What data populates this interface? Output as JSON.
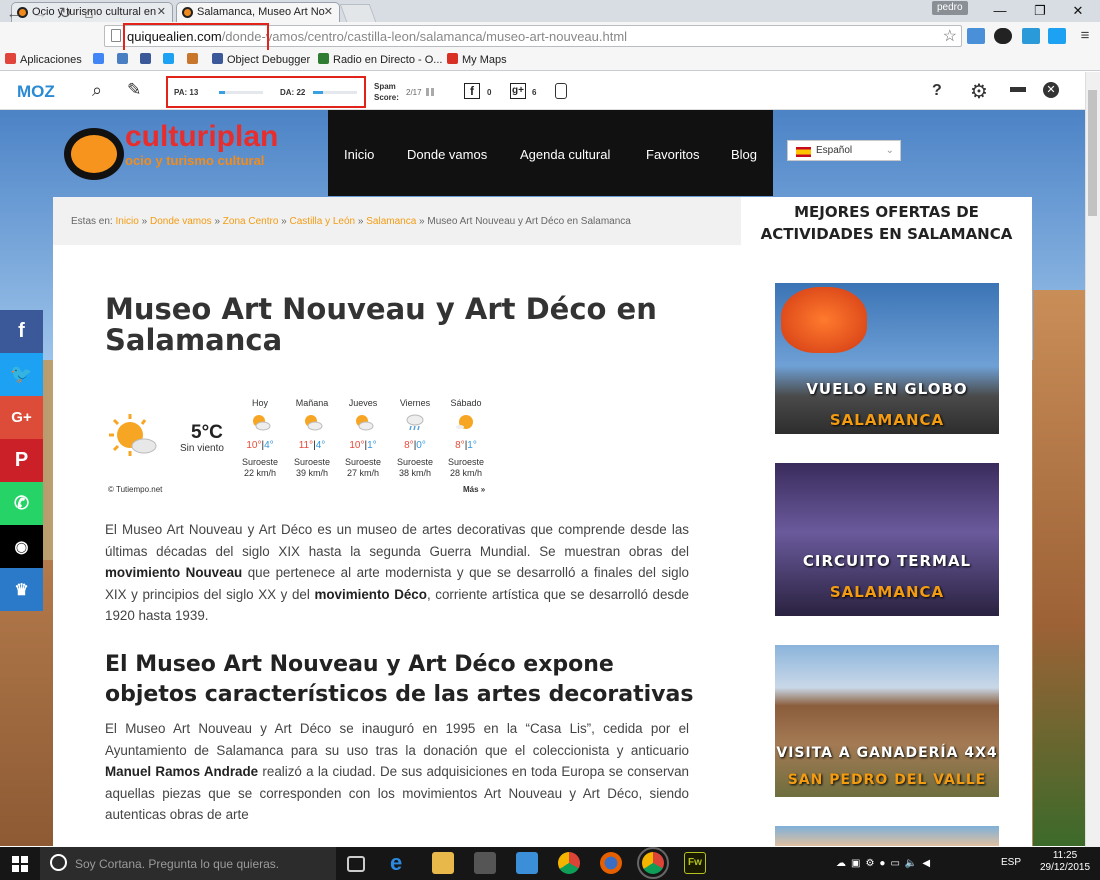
{
  "browser": {
    "tabs": [
      {
        "title": "Ocio y turismo cultural en",
        "active": false
      },
      {
        "title": "Salamanca, Museo Art Nou",
        "active": true
      }
    ],
    "user_badge": "pedro",
    "url_domain": "quiquealien.com",
    "url_path": "/donde-vamos/centro/castilla-leon/salamanca/museo-art-nouveau.html",
    "bookmarks": [
      {
        "label": "Aplicaciones",
        "color": "#e0443a"
      },
      {
        "label": "",
        "color": "#4285f4"
      },
      {
        "label": "",
        "color": "#3b5998"
      },
      {
        "label": "",
        "color": "#1da1f2"
      },
      {
        "label": "",
        "color": "#c7762b"
      },
      {
        "label": "Object Debugger",
        "color": "#3b5998"
      },
      {
        "label": "Radio en Directo - O...",
        "color": "#2e7d32"
      },
      {
        "label": "My Maps",
        "color": "#d93025"
      }
    ]
  },
  "mozbar": {
    "logo": "MOZ",
    "pa_label": "PA: 13",
    "pa_value": 13,
    "da_label": "DA: 22",
    "da_value": 22,
    "spam_label_1": "Spam",
    "spam_label_2": "Score:",
    "spam_value": "2/17",
    "fb_count": "0",
    "gplus_count": "6",
    "help": "?"
  },
  "site": {
    "logo_name": "culturiplan",
    "logo_tagline": "ocio y turismo cultural",
    "nav": [
      "Inicio",
      "Donde vamos",
      "Agenda cultural",
      "Favoritos",
      "Blog"
    ],
    "language": "Español",
    "breadcrumb": {
      "prefix": "Estas en:",
      "links": [
        "Inicio",
        "Donde vamos",
        "Zona Centro",
        "Castilla y León",
        "Salamanca"
      ],
      "current": "Museo Art Nouveau y Art Déco en Salamanca"
    },
    "title": "Museo Art Nouveau y Art Déco en Salamanca",
    "weather": {
      "now_temp": "5°C",
      "now_condition": "Sin viento",
      "days": [
        {
          "day": "Hoy",
          "hi": "10°",
          "lo": "4°",
          "dir": "Suroeste",
          "wind": "22 km/h"
        },
        {
          "day": "Mañana",
          "hi": "11°",
          "lo": "4°",
          "dir": "Suroeste",
          "wind": "39 km/h"
        },
        {
          "day": "Jueves",
          "hi": "10°",
          "lo": "1°",
          "dir": "Suroeste",
          "wind": "27 km/h"
        },
        {
          "day": "Viernes",
          "hi": "8°",
          "lo": "0°",
          "dir": "Suroeste",
          "wind": "38 km/h"
        },
        {
          "day": "Sábado",
          "hi": "8°",
          "lo": "1°",
          "dir": "Suroeste",
          "wind": "28 km/h"
        }
      ],
      "credit": "© Tutiempo.net",
      "more": "Más »"
    },
    "para1": {
      "a": "El Museo Art Nouveau y Art Déco es un museo de artes decorativas que comprende desde las últimas décadas del siglo XIX hasta la segunda Guerra Mundial. Se muestran obras del ",
      "b1": "movimiento Nouveau",
      "c": " que pertenece al arte modernista y que se desarrolló a finales del siglo XIX y principios del siglo XX y del ",
      "b2": "movimiento Déco",
      "d": ", corriente artística que se desarrolló desde 1920 hasta 1939."
    },
    "h2": "El Museo Art Nouveau y Art Déco expone objetos característicos de las artes decorativas",
    "para2": {
      "a": "El Museo Art Nouveau y Art Déco se inauguró en 1995 en la “Casa Lis”, cedida por el Ayuntamiento de Salamanca para su uso tras la donación que el coleccionista y anticuario ",
      "b": "Manuel Ramos Andrade",
      "c": " realizó a la ciudad. De sus adquisiciones en toda Europa se conservan aquellas piezas que se corresponden con los movimientos Art Nouveau y Art Déco, siendo autenticas obras de arte"
    },
    "sidebar": {
      "title": "MEJORES OFERTAS DE ACTIVIDADES EN SALAMANCA",
      "ads": [
        {
          "line1": "VUELO EN GLOBO",
          "line2": "SALAMANCA"
        },
        {
          "line1": "CIRCUITO TERMAL",
          "line2": "SALAMANCA"
        },
        {
          "line1": "VISITA A GANADERÍA 4X4",
          "line2": "SAN PEDRO DEL VALLE"
        }
      ]
    },
    "social": [
      {
        "name": "facebook",
        "glyph": "f",
        "color": "#3b5998"
      },
      {
        "name": "twitter",
        "glyph": "",
        "color": "#1da1f2"
      },
      {
        "name": "google-plus",
        "glyph": "G+",
        "color": "#dd4b39"
      },
      {
        "name": "pinterest",
        "glyph": "P",
        "color": "#cb2027"
      },
      {
        "name": "whatsapp",
        "glyph": "",
        "color": "#25d366"
      },
      {
        "name": "tripadvisor",
        "glyph": "",
        "color": "#000000"
      },
      {
        "name": "bookmark",
        "glyph": "",
        "color": "#2a7ac9"
      }
    ]
  },
  "taskbar": {
    "cortana": "Soy Cortana. Pregunta lo que quieras.",
    "lang": "ESP",
    "time": "11:25",
    "date": "29/12/2015"
  }
}
